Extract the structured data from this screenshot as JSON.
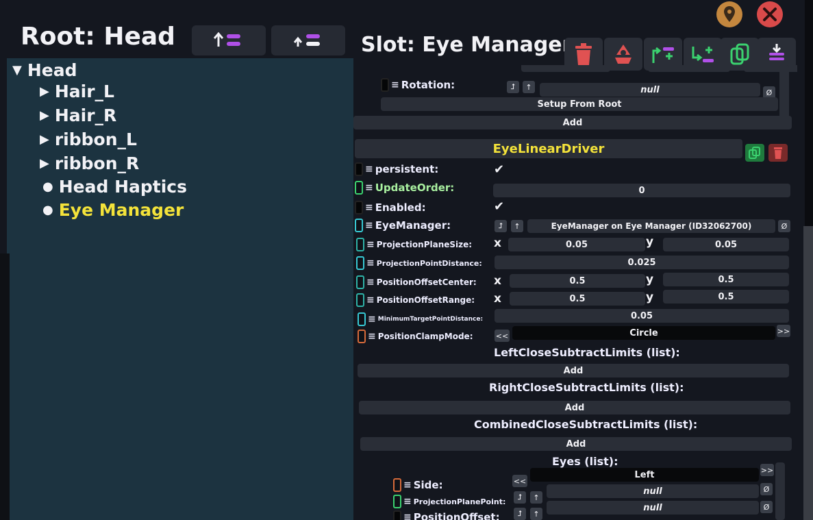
{
  "hierarchy": {
    "title": "Root: Head",
    "items": [
      {
        "label": "Head",
        "marker": "▼"
      },
      {
        "label": "Hair_L",
        "marker": "▶"
      },
      {
        "label": "Hair_R",
        "marker": "▶"
      },
      {
        "label": "ribbon_L",
        "marker": "▶"
      },
      {
        "label": "ribbon_R",
        "marker": "▶"
      },
      {
        "label": "Head Haptics",
        "marker": "●"
      },
      {
        "label": "Eye Manager",
        "marker": "●",
        "selected": true
      }
    ]
  },
  "inspector": {
    "title": "Slot: Eye Manager",
    "upper": {
      "rotation_label": "Rotation:",
      "rotation_value": "null",
      "setup_button": "Setup From Root",
      "add_button": "Add"
    },
    "component": {
      "name": "EyeLinearDriver",
      "persistent_label": "persistent:",
      "update_order_label": "UpdateOrder:",
      "update_order_value": "0",
      "enabled_label": "Enabled:",
      "eye_manager_label": "EyeManager:",
      "eye_manager_value": "EyeManager on Eye Manager (ID32062700)",
      "projection_plane_size_label": "ProjectionPlaneSize:",
      "projection_plane_size_x": "0.05",
      "projection_plane_size_y": "0.05",
      "projection_point_distance_label": "ProjectionPointDistance:",
      "projection_point_distance_value": "0.025",
      "position_offset_center_label": "PositionOffsetCenter:",
      "position_offset_center_x": "0.5",
      "position_offset_center_y": "0.5",
      "position_offset_range_label": "PositionOffsetRange:",
      "position_offset_range_x": "0.5",
      "position_offset_range_y": "0.5",
      "min_target_label": "MinimumTargetPointDistance:",
      "min_target_value": "0.05",
      "clamp_mode_label": "PositionClampMode:",
      "clamp_mode_value": "Circle",
      "x_axis": "x",
      "y_axis": "y",
      "left_list": "LeftCloseSubtractLimits (list):",
      "right_list": "RightCloseSubtractLimits (list):",
      "combined_list": "CombinedCloseSubtractLimits (list):",
      "add_label": "Add",
      "eyes_list": "Eyes (list):",
      "side_label": "Side:",
      "side_value": "Left",
      "projection_plane_point_label": "ProjectionPlanePoint:",
      "projection_plane_point_value": "null",
      "position_offset_label": "PositionOffset:",
      "position_offset_value": "null",
      "null_symbol": "Ø",
      "prev_symbol": "<<",
      "next_symbol": ">>",
      "check_symbol": "✔"
    }
  },
  "colors": {
    "tree_bg": "#1c3340",
    "selected_text": "#f4e33a",
    "panel_bg": "#14171f",
    "field_bg": "#2a2e37",
    "accent_purple": "#b050e8",
    "accent_green": "#3bd16f",
    "accent_red": "#e05252"
  }
}
